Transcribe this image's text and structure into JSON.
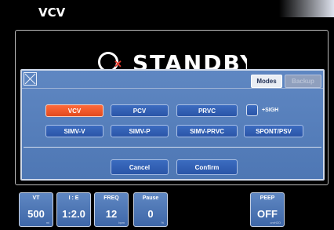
{
  "header": {
    "mode": "VCV"
  },
  "status": {
    "standby_text": "STANDBY"
  },
  "dialog": {
    "close_label": "close",
    "tabs": [
      {
        "label": "Modes",
        "active": true
      },
      {
        "label": "Backup",
        "active": false
      }
    ],
    "modes_row1": [
      {
        "label": "VCV",
        "selected": true
      },
      {
        "label": "PCV",
        "selected": false
      },
      {
        "label": "PRVC",
        "selected": false
      }
    ],
    "sigh_label": "+SIGH",
    "modes_row2": [
      {
        "label": "SIMV-V"
      },
      {
        "label": "SIMV-P"
      },
      {
        "label": "SIMV-PRVC"
      },
      {
        "label": "SPONT/PSV"
      }
    ],
    "cancel_label": "Cancel",
    "confirm_label": "Confirm"
  },
  "params": [
    {
      "label": "VT",
      "value": "500",
      "unit": "ml"
    },
    {
      "label": "I : E",
      "value": "1:2.0",
      "unit": ""
    },
    {
      "label": "FREQ",
      "value": "12",
      "unit": "bpm"
    },
    {
      "label": "Pause",
      "value": "0",
      "unit": "%"
    },
    {
      "label": "PEEP",
      "value": "OFF",
      "unit": "cmH2O"
    }
  ],
  "colors": {
    "selected_mode": "#e24a1e",
    "button_blue": "#2a55a8",
    "dialog_bg": "#5f87c2"
  }
}
